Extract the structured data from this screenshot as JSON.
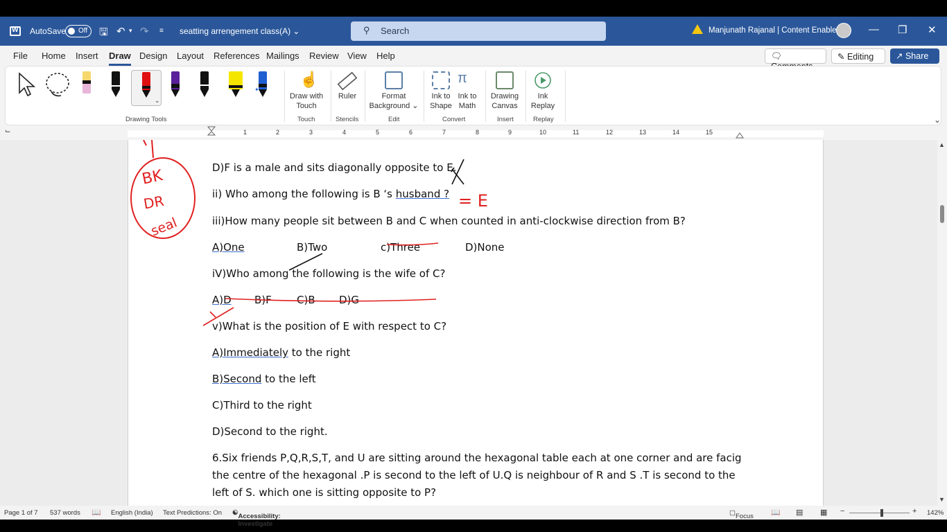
{
  "titlebar": {
    "autosave_label": "AutoSave",
    "autosave_state": "Off",
    "doc_title": "seatting arrengement class(A)",
    "search_placeholder": "Search",
    "user_name": "Manjunath Rajanal | Content Enablers",
    "minimize": "—",
    "restore": "❐",
    "close": "✕"
  },
  "menu": {
    "items": [
      "File",
      "Home",
      "Insert",
      "Draw",
      "Design",
      "Layout",
      "References",
      "Mailings",
      "Review",
      "View",
      "Help"
    ],
    "active": "Draw",
    "comments": "Comments",
    "editing": "Editing",
    "share": "Share"
  },
  "ribbon": {
    "drawing_tools_label": "Drawing Tools",
    "draw_with_touch": "Draw with Touch",
    "ruler": "Ruler",
    "format_background": "Format Background",
    "ink_to_shape": "Ink to Shape",
    "ink_to_math": "Ink to Math",
    "drawing_canvas": "Drawing Canvas",
    "ink_replay": "Ink Replay",
    "groups": {
      "touch": "Touch",
      "stencils": "Stencils",
      "edit": "Edit",
      "convert": "Convert",
      "insert": "Insert",
      "replay": "Replay"
    },
    "pen_colors": [
      "#e8b6d8",
      "#111111",
      "#e01010",
      "#5a1f9a",
      "#111111",
      "#f5e600",
      "#1f5fd1"
    ]
  },
  "ruler": {
    "numbers": [
      "1",
      "2",
      "3",
      "4",
      "5",
      "6",
      "7",
      "8",
      "9",
      "10",
      "11",
      "12",
      "13",
      "14",
      "15"
    ]
  },
  "document": {
    "line_d": "D)F is a male and sits diagonally opposite to E.",
    "q2_pre": "ii) Who among the following is B ‘s ",
    "q2_link": "husband ?",
    "q3": "iii)How many people sit between B and C when counted in anti-clockwise direction from B?",
    "q3_opts": [
      "A)One",
      "B)Two",
      "c)Three",
      "D)None"
    ],
    "q4": "iV)Who among the following is the wife of C?",
    "q4_opts": [
      "A)D",
      "B)F",
      "C)B",
      "D)G"
    ],
    "q5": "v)What is the position of E with respect to C?",
    "q5_a_link": "A)Immediately",
    "q5_a_rest": " to the right",
    "q5_b_link": "B)Second",
    "q5_b_rest": " to the left",
    "q5_c": "C)Third to the right",
    "q5_d": "D)Second to the right.",
    "q6_line1": "6.Six friends P,Q,R,S,T, and U are sitting around the hexagonal table each at one corner and are facig",
    "q6_line2": "the centre of the hexagonal .P is second to the left of U.Q is neighbour of R and S .T is second to the",
    "q6_line3": "left of S. which one is sitting opposite to P?",
    "ink_note_1": "BK",
    "ink_note_2": "DR",
    "ink_note_3": "seal",
    "ink_answer": "= E"
  },
  "status": {
    "page": "Page 1 of 7",
    "words": "537 words",
    "language": "English (India)",
    "predictions": "Text Predictions: On",
    "accessibility": "Accessibility: Investigate",
    "focus": "Focus",
    "zoom": "142%"
  }
}
